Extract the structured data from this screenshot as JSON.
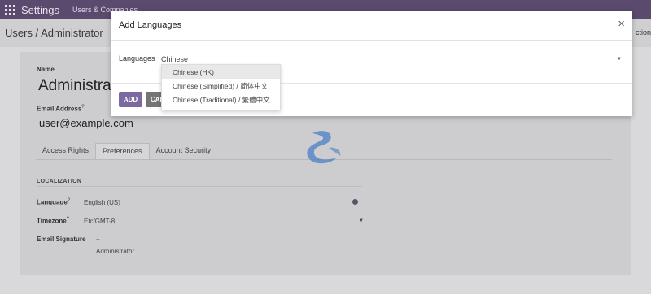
{
  "navbar": {
    "app_title": "Settings",
    "menu_item": "Users & Companies"
  },
  "control_panel": {
    "breadcrumb": "Users / Administrator",
    "action": "ction"
  },
  "form": {
    "name_label": "Name",
    "name_value": "Administrator",
    "email_label": "Email Address",
    "email_value": "user@example.com",
    "tabs": [
      {
        "label": "Access Rights",
        "active": false
      },
      {
        "label": "Preferences",
        "active": true
      },
      {
        "label": "Account Security",
        "active": false
      }
    ],
    "section_title": "LOCALIZATION",
    "language_label": "Language",
    "language_value": "English (US)",
    "timezone_label": "Timezone",
    "timezone_value": "Etc/GMT-8",
    "signature_label": "Email Signature",
    "signature_separator": "--",
    "signature_value": "Administrator",
    "help_mark": "?"
  },
  "modal": {
    "title": "Add Languages",
    "close_label": "×",
    "languages_label": "Languages",
    "languages_input": "Chinese",
    "add_button": "ADD",
    "cancel_button": "CANCEL"
  },
  "dropdown": {
    "items": [
      "Chinese (HK)",
      "Chinese (Simplified) / 简体中文",
      "Chinese (Traditional) / 繁體中文"
    ]
  },
  "colors": {
    "navbar": "#5a4a6e",
    "primary_button": "#7b6aa1",
    "watermark": "#4a7fc4"
  }
}
